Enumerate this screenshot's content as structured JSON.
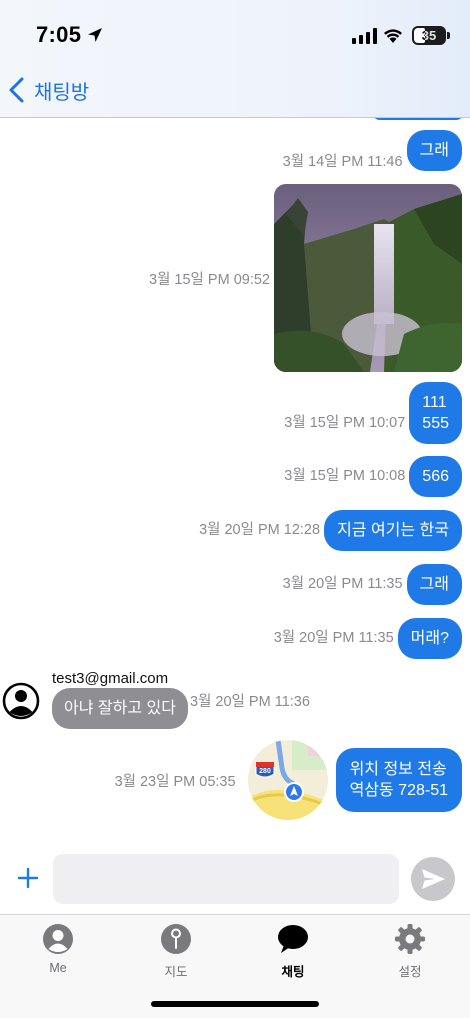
{
  "status_bar": {
    "time": "7:05",
    "battery": "35"
  },
  "nav": {
    "back_label": "채팅방"
  },
  "messages": [
    {
      "time": "3월 14일 PM 11:46",
      "text": "그래"
    },
    {
      "time": "3월 15일 PM 09:52",
      "type": "image"
    },
    {
      "time": "3월 15일 PM 10:07",
      "text": "111\n555"
    },
    {
      "time": "3월 15일 PM 10:08",
      "text": "566"
    },
    {
      "time": "3월 20일 PM 12:28",
      "text": "지금 여기는 한국"
    },
    {
      "time": "3월 20일 PM 11:35",
      "text": "그래"
    },
    {
      "time": "3월 20일 PM 11:35",
      "text": "머래?"
    }
  ],
  "incoming": {
    "sender": "test3@gmail.com",
    "text": "아냐 잘하고 있다",
    "time": "3월 20일 PM 11:36"
  },
  "location_message": {
    "time": "3월 23일 PM 05:35",
    "line1": "위치 정보 전송",
    "line2": "역삼동 728-51",
    "map_shield": "280"
  },
  "input": {
    "placeholder": "",
    "value": ""
  },
  "tabs": [
    {
      "label": "Me",
      "icon": "person-icon"
    },
    {
      "label": "지도",
      "icon": "map-pin-icon"
    },
    {
      "label": "채팅",
      "icon": "chat-bubble-icon",
      "active": true
    },
    {
      "label": "설정",
      "icon": "gear-icon"
    }
  ],
  "colors": {
    "accent": "#1f7ae8",
    "incoming_bubble": "#8e8e93",
    "timestamp": "#8a8a8e"
  }
}
